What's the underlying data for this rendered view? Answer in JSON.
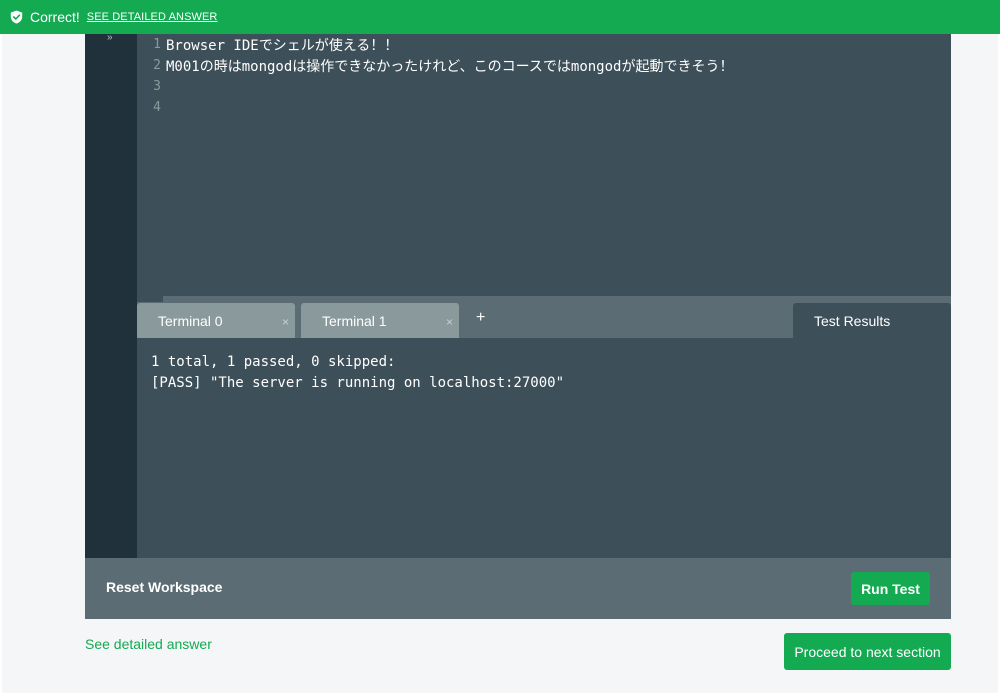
{
  "banner": {
    "status_icon": "shield-check-icon",
    "status_text": "Correct!",
    "detail_link": "SEE DETAILED ANSWER",
    "color": "#13aa52"
  },
  "editor": {
    "lines": [
      {
        "num": "1",
        "text": "Browser IDEでシェルが使える！！"
      },
      {
        "num": "2",
        "text": "M001の時はmongodは操作できなかったけれど、このコースではmongodが起動できそう！"
      },
      {
        "num": "3",
        "text": ""
      },
      {
        "num": "4",
        "text": ""
      }
    ]
  },
  "tabs": {
    "terminals": [
      {
        "label": "Terminal 0",
        "close": "×"
      },
      {
        "label": "Terminal 1",
        "close": "×"
      }
    ],
    "add": "+",
    "results": "Test Results"
  },
  "results": {
    "lines": [
      "1 total, 1 passed, 0 skipped:",
      "[PASS] \"The server is running on localhost:27000\""
    ]
  },
  "footer": {
    "reset": "Reset Workspace",
    "run": "Run Test"
  },
  "bottom": {
    "detail_link": "See detailed answer",
    "proceed": "Proceed to next section"
  }
}
